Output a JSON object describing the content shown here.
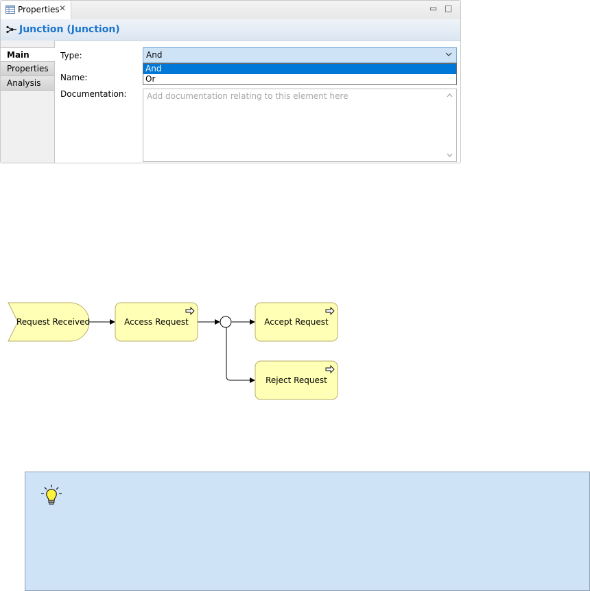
{
  "view": {
    "tab_label": "Properties",
    "close_glyph": "✕",
    "minimize_glyph": "▭",
    "maximize_glyph": "□",
    "icons": {
      "tab": "properties-table-icon",
      "title": "junction-icon"
    }
  },
  "title": "Junction (Junction)",
  "side_tabs": [
    "Main",
    "Properties",
    "Analysis"
  ],
  "fields": {
    "type_label": "Type:",
    "type_value": "And",
    "type_options": [
      "And",
      "Or"
    ],
    "name_label": "Name:",
    "documentation_label": "Documentation:",
    "documentation_placeholder": "Add documentation relating to this element here"
  },
  "diagram": {
    "nodes": {
      "event": "Request Received",
      "access": "Access Request",
      "accept": "Accept Request",
      "reject": "Reject Request"
    }
  },
  "colors": {
    "title": "#1b75cf",
    "node_fill": "#ffffb5",
    "node_stroke": "#b7ae6a",
    "tip_bg": "#cfe3f6",
    "selection": "#0078d7"
  }
}
